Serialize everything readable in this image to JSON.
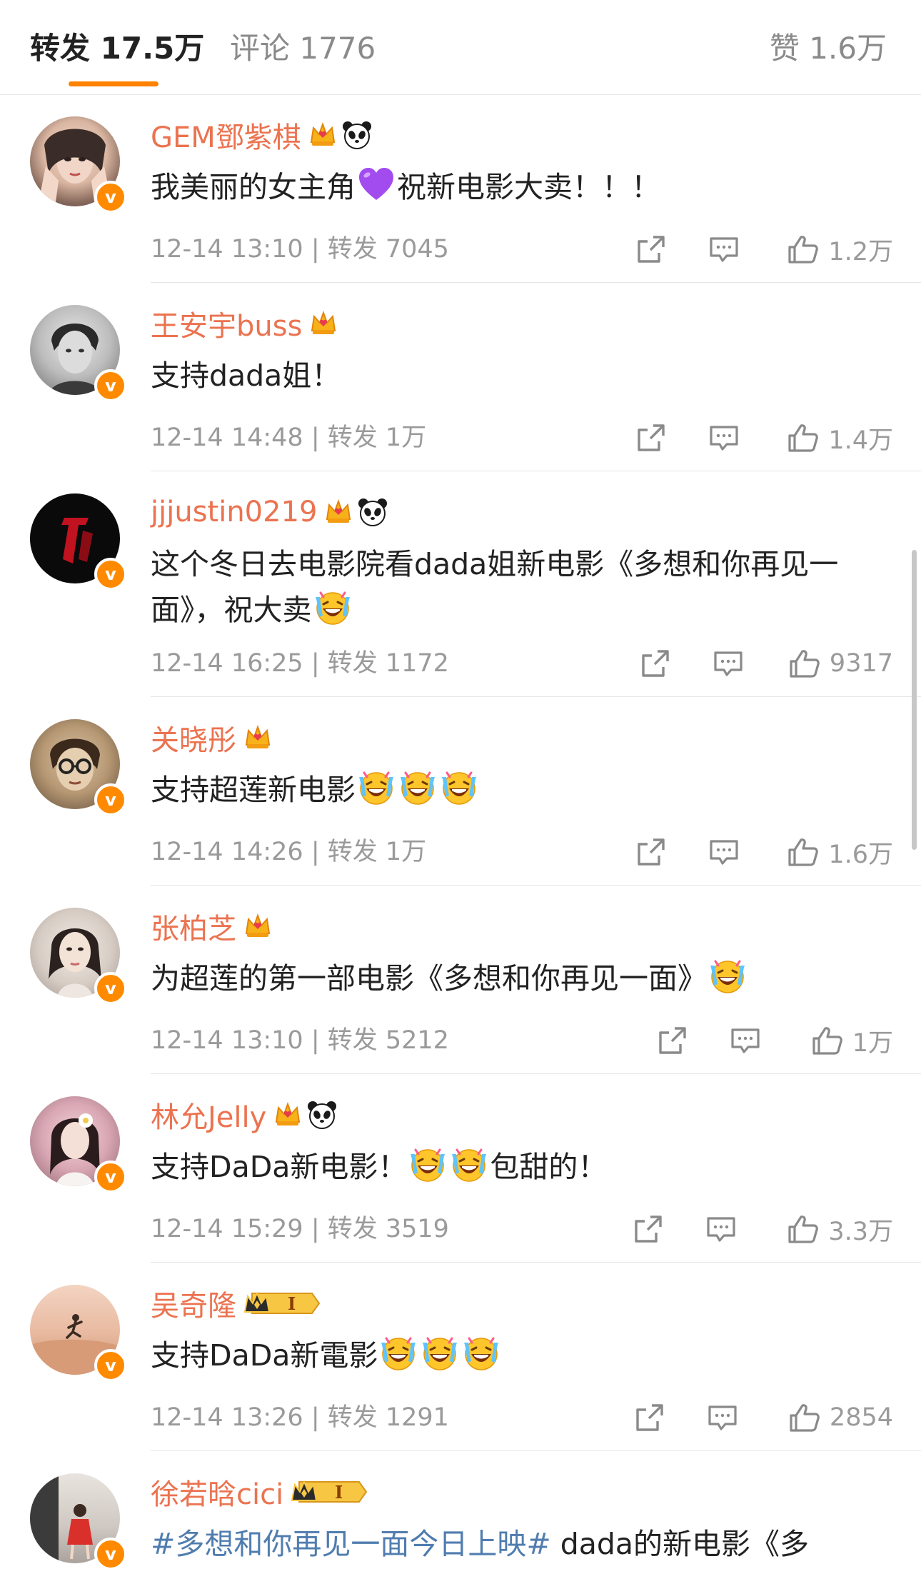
{
  "tabs": {
    "repost_label": "转发 17.5万",
    "comment_label": "评论 1776",
    "like_label": "赞 1.6万",
    "accent": "#ff8200"
  },
  "verified_badge_char": "v",
  "rows": [
    {
      "name": "GEM鄧紫棋",
      "badges": [
        "crown-icon",
        "panda-icon"
      ],
      "content_before": "我美丽的女主角",
      "content_after": "祝新电影大卖！！！",
      "inline": [
        "purple-heart-icon"
      ],
      "meta": "12-14 13:10 | 转发 7045",
      "likes": "1.2万"
    },
    {
      "name": "王安宇buss",
      "badges": [
        "crown-icon"
      ],
      "content_before": "支持dada姐！",
      "content_after": "",
      "inline": [],
      "meta": "12-14 14:48 | 转发 1万",
      "likes": "1.4万"
    },
    {
      "name": "jjjustin0219",
      "badges": [
        "crown-icon",
        "panda-icon"
      ],
      "content_before": "这个冬日去电影院看dada姐新电影《多想和你再见一面》，祝大卖",
      "content_after": "",
      "inline": [
        "laugh-cry-emoji"
      ],
      "meta": "12-14 16:25 | 转发 1172",
      "likes": "9317"
    },
    {
      "name": "关晓彤",
      "badges": [
        "crown-icon"
      ],
      "content_before": "支持超莲新电影",
      "content_after": "",
      "inline": [
        "laugh-cry-emoji",
        "laugh-cry-emoji",
        "laugh-cry-emoji"
      ],
      "meta": "12-14 14:26 | 转发 1万",
      "likes": "1.6万"
    },
    {
      "name": "张柏芝",
      "badges": [
        "crown-icon"
      ],
      "content_before": "为超莲的第一部电影《多想和你再见一面》",
      "content_after": "",
      "inline": [
        "laugh-cry-emoji"
      ],
      "meta": "12-14 13:10 | 转发 5212",
      "likes": "1万"
    },
    {
      "name": "林允Jelly",
      "badges": [
        "crown-icon",
        "panda-icon"
      ],
      "content_before": "支持DaDa新电影！",
      "content_after": "包甜的！",
      "inline": [
        "laugh-cry-emoji",
        "laugh-cry-emoji"
      ],
      "meta": "12-14 15:29 | 转发 3519",
      "likes": "3.3万"
    },
    {
      "name": "吴奇隆",
      "badges": [
        "level-1-icon"
      ],
      "level_text": "I",
      "content_before": "支持DaDa新電影",
      "content_after": "",
      "inline": [
        "laugh-cry-emoji",
        "laugh-cry-emoji",
        "laugh-cry-emoji"
      ],
      "meta": "12-14 13:26 | 转发 1291",
      "likes": "2854"
    },
    {
      "name": "徐若晗cici",
      "badges": [
        "level-1-icon"
      ],
      "level_text": "I",
      "content_tag": "#多想和你再见一面今日上映#",
      "content_before": " dada的新电影《多",
      "content_after": "",
      "inline": [],
      "meta": "",
      "likes": ""
    }
  ]
}
